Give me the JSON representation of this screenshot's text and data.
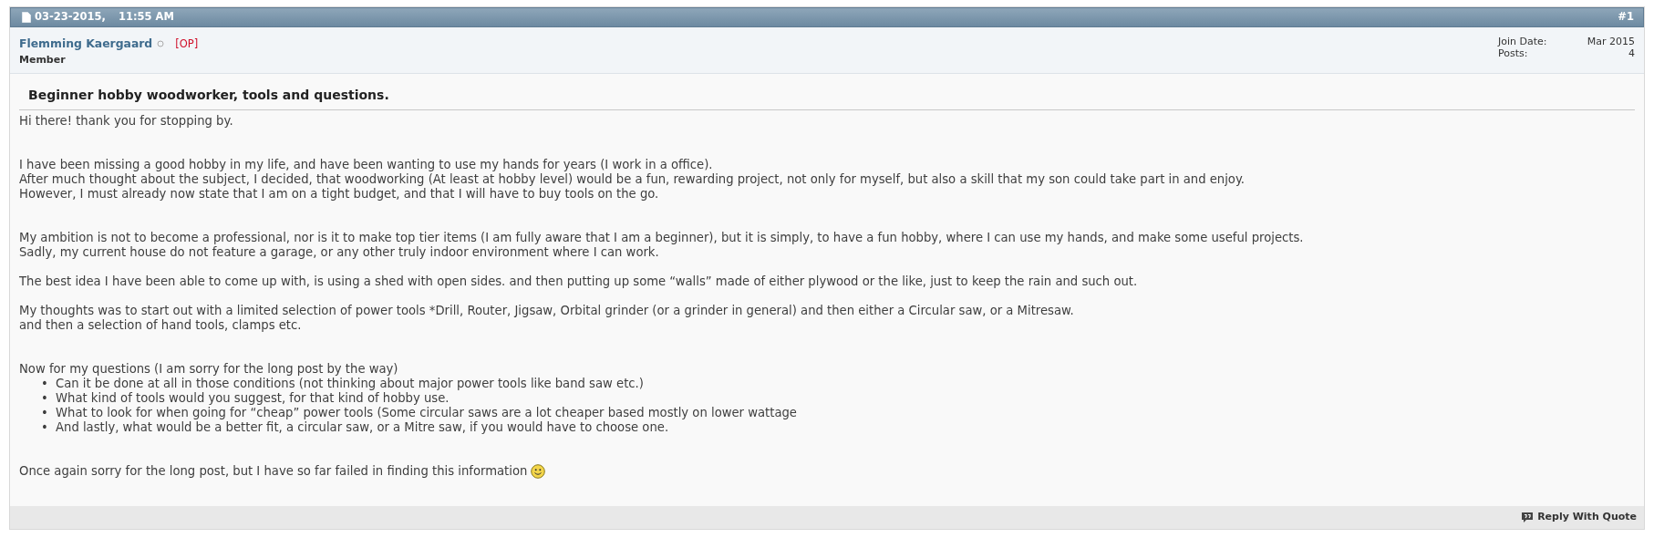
{
  "post": {
    "date": "03-23-2015,",
    "time": "11:55 AM",
    "number": "#1"
  },
  "author": {
    "name": "Flemming Kaergaard",
    "online": false,
    "op_tag": "[OP]",
    "rank": "Member"
  },
  "stats": [
    {
      "label": "Join Date:",
      "value": "Mar 2015"
    },
    {
      "label": "Posts:",
      "value": "4"
    }
  ],
  "title": "Beginner hobby woodworker, tools and questions.",
  "body": [
    {
      "kind": "text",
      "lines": [
        "Hi there! thank you for stopping by."
      ]
    },
    {
      "kind": "break"
    },
    {
      "kind": "break"
    },
    {
      "kind": "text",
      "lines": [
        "I have been missing a good hobby in my life, and have been wanting to use my hands for years (I work in a office).",
        "After much thought about the subject, I decided, that woodworking (At least at hobby level) would be a fun, rewarding project, not only for myself, but also a skill that my son could take part in and enjoy.",
        "However, I must already now state that I am on a tight budget, and that I will have to buy tools on the go."
      ]
    },
    {
      "kind": "break"
    },
    {
      "kind": "break"
    },
    {
      "kind": "text",
      "lines": [
        "My ambition is not to become a professional, nor is it to make top tier items (I am fully aware that I am a beginner), but it is simply, to have a fun hobby, where I can use my hands, and make some useful projects.",
        "Sadly, my current house do not feature a garage, or any other truly indoor environment where I can work."
      ]
    },
    {
      "kind": "break"
    },
    {
      "kind": "text",
      "lines": [
        "The best idea I have been able to come up with, is using a shed with open sides. and then putting up some “walls” made of either plywood or the like, just to keep the rain and such out."
      ]
    },
    {
      "kind": "break"
    },
    {
      "kind": "text",
      "lines": [
        "My thoughts was to start out with a limited selection of power tools *Drill, Router, Jigsaw, Orbital grinder (or a grinder in general) and then either a Circular saw, or a Mitresaw.",
        "and then a selection of hand tools, clamps etc."
      ]
    },
    {
      "kind": "break"
    },
    {
      "kind": "break"
    },
    {
      "kind": "text",
      "lines": [
        "Now for my questions (I am sorry for the long post by the way)"
      ]
    },
    {
      "kind": "list",
      "items": [
        {
          "marker": "•",
          "text": "Can it be done at all in those conditions (not thinking about major power tools like band saw etc.)"
        },
        {
          "marker": "•",
          "text": "What kind of tools would you suggest, for that kind of hobby use."
        },
        {
          "marker": "•",
          "text": "What to look for when going for “cheap” power tools (Some circular saws are a lot cheaper based mostly on lower wattage"
        },
        {
          "marker": "•",
          "text": "And lastly, what would be a better fit, a circular saw, or a Mitre saw, if you would have to choose one."
        }
      ]
    },
    {
      "kind": "break"
    },
    {
      "kind": "break"
    },
    {
      "kind": "smiley",
      "lines": [
        "Once again sorry for the long post, but I have so far failed in finding this information"
      ]
    }
  ],
  "actions": [
    {
      "label": "Reply With Quote"
    }
  ]
}
